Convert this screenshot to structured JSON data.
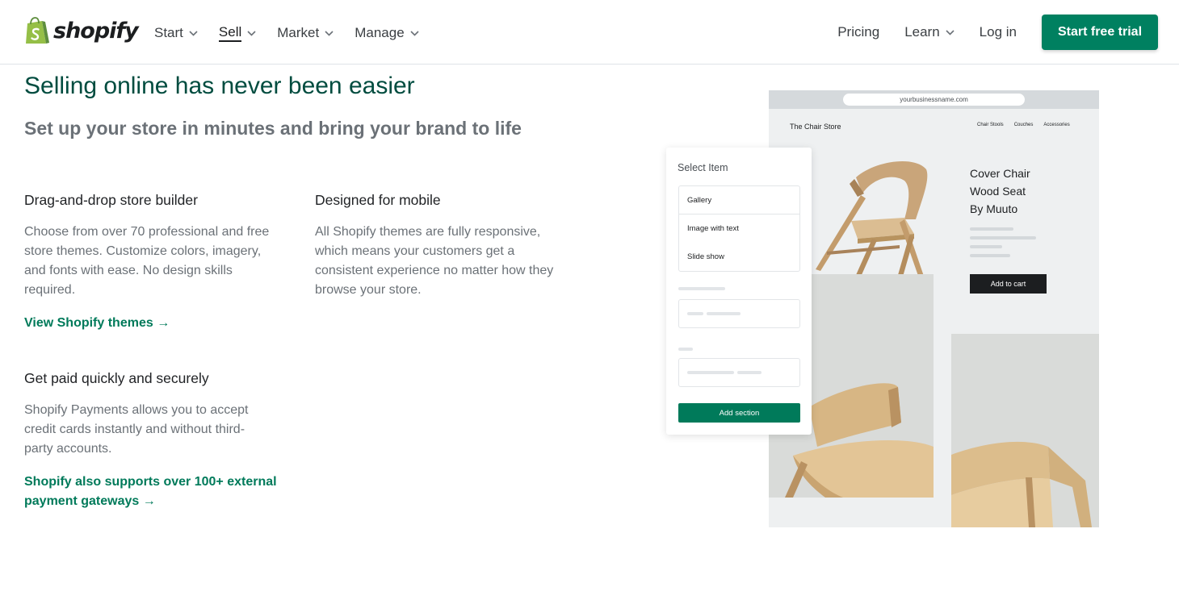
{
  "header": {
    "logo_text": "shopify",
    "nav": [
      {
        "label": "Start"
      },
      {
        "label": "Sell"
      },
      {
        "label": "Market"
      },
      {
        "label": "Manage"
      }
    ],
    "active_nav": "Sell",
    "right": {
      "pricing": "Pricing",
      "learn": "Learn",
      "login": "Log in",
      "cta": "Start free trial"
    }
  },
  "hero": {
    "headline": "Selling online has never been easier",
    "subhead": "Set up your store in minutes and bring your brand to life"
  },
  "features": [
    {
      "title": "Drag-and-drop store builder",
      "body": "Choose from over 70 professional and free store themes. Customize colors, imagery, and fonts with ease. No design skills required.",
      "link": "View Shopify themes"
    },
    {
      "title": "Designed for mobile",
      "body": "All Shopify themes are fully responsive, which means your customers get a consistent experience no matter how they browse your store."
    },
    {
      "title": "Get paid quickly and securely",
      "body": "Shopify Payments allows you to accept credit cards instantly and without third-party accounts.",
      "link_line1": "Shopify also supports over 100+ external",
      "link_line2": "payment gateways"
    }
  ],
  "mockup": {
    "url": "yourbusinessname.com",
    "store_name": "The Chair Store",
    "store_nav": [
      "Chair Stools",
      "Couches",
      "Accessories"
    ],
    "product_title": [
      "Cover Chair",
      "Wood Seat",
      "By Muuto"
    ],
    "add_to_cart": "Add to cart",
    "panel": {
      "title": "Select Item",
      "items": [
        "Gallery",
        "Image with text",
        "Slide show"
      ],
      "add_section": "Add section"
    }
  },
  "colors": {
    "brand_green": "#008060",
    "headline_green": "#004c3f",
    "link_green": "#007a5a",
    "logo_green": "#95bf47"
  },
  "icons": {
    "arrow": "→",
    "chevron": "chevron-down-icon",
    "logo": "shopify-bag-icon"
  }
}
